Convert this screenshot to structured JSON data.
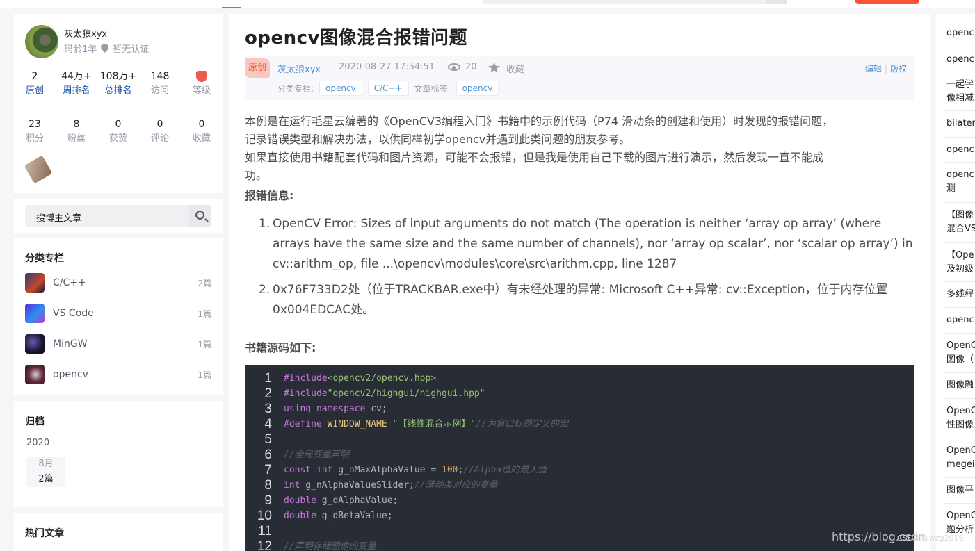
{
  "profile": {
    "name": "灰太狼xyx",
    "age": "码龄1年",
    "cert": "暂无认证",
    "stats_row1": [
      {
        "num": "2",
        "label": "原创"
      },
      {
        "num": "44万+",
        "label": "周排名"
      },
      {
        "num": "108万+",
        "label": "总排名"
      },
      {
        "num": "148",
        "label": "访问"
      },
      {
        "num": "",
        "label": "等级"
      }
    ],
    "stats_row2": [
      {
        "num": "23",
        "label": "积分"
      },
      {
        "num": "8",
        "label": "粉丝"
      },
      {
        "num": "0",
        "label": "获赞"
      },
      {
        "num": "0",
        "label": "评论"
      },
      {
        "num": "0",
        "label": "收藏"
      }
    ]
  },
  "search": {
    "placeholder": "搜博主文章"
  },
  "categories": {
    "title": "分类专栏",
    "items": [
      {
        "name": "C/C++",
        "count": "2篇"
      },
      {
        "name": "VS Code",
        "count": "1篇"
      },
      {
        "name": "MinGW",
        "count": "1篇"
      },
      {
        "name": "opencv",
        "count": "1篇"
      }
    ]
  },
  "archive": {
    "title": "归档",
    "year": "2020",
    "month": "8月",
    "count": "2篇"
  },
  "hot": {
    "title": "热门文章"
  },
  "article": {
    "title": "opencv图像混合报错问题",
    "badge": "原创",
    "author": "灰太狼xyx",
    "date": "2020-08-27 17:54:51",
    "views": "20",
    "fav": "收藏",
    "edit": "编辑",
    "copyright": "版权",
    "column_label": "分类专栏:",
    "columns": [
      "opencv",
      "C/C++"
    ],
    "tag_label": "文章标签:",
    "tags": [
      "opencv"
    ],
    "para1a": "本例是在运行毛星云编著的《OpenCV3编程入门》书籍中的示例代码（P74 滑动条的创建和使用）时发现的报错问题，",
    "para1b": "记录错误类型和解决办法，以供同样初学opencv并遇到此类问题的朋友参考。",
    "para2a": "如果直接使用书籍配套代码和图片资源，可能不会报错，但是我是使用自己下载的图片进行演示，然后发现一直不能成",
    "para2b": "功。",
    "err_heading": "报错信息:",
    "errors": [
      "OpenCV Error: Sizes of input arguments do not match (The operation is neither ‘array op array’ (where arrays have the same size and the same number of channels), nor ‘array op scalar’, nor ‘scalar op array’) in cv::arithm_op, file ...\\opencv\\modules\\core\\src\\arithm.cpp, line 1287",
      "0x76F733D2处（位于TRACKBAR.exe中）有未经处理的异常: Microsoft C++异常: cv::Exception，位于内存位置 0x004EDCAC处。"
    ],
    "code_heading": "书籍源码如下:"
  },
  "code": {
    "line_numbers": [
      "1",
      "2",
      "3",
      "4",
      "5",
      "6",
      "7",
      "8",
      "9",
      "10",
      "11",
      "12"
    ],
    "lines": [
      [
        {
          "t": "#include",
          "c": "kw"
        },
        {
          "t": "<opencv2/opencv.hpp>",
          "c": "str"
        }
      ],
      [
        {
          "t": "#include",
          "c": "kw"
        },
        {
          "t": "\"opencv2/highgui/highgui.hpp\"",
          "c": "str"
        }
      ],
      [
        {
          "t": "using",
          "c": "kw"
        },
        {
          "t": " "
        },
        {
          "t": "namespace",
          "c": "kw"
        },
        {
          "t": " cv;"
        }
      ],
      [
        {
          "t": "#define",
          "c": "kw"
        },
        {
          "t": " WINDOW_NAME ",
          "c": "def"
        },
        {
          "t": "\"【线性混合示例】\"",
          "c": "str"
        },
        {
          "t": "//为窗口标题定义的宏",
          "c": "cmt"
        }
      ],
      [],
      [
        {
          "t": "//全局变量声明",
          "c": "cmt"
        }
      ],
      [
        {
          "t": "const",
          "c": "kw"
        },
        {
          "t": " "
        },
        {
          "t": "int",
          "c": "kw"
        },
        {
          "t": " g_nMaxAlphaValue = "
        },
        {
          "t": "100",
          "c": "num-c"
        },
        {
          "t": ";"
        },
        {
          "t": "//Alpha值的最大值",
          "c": "cmt"
        }
      ],
      [
        {
          "t": "int",
          "c": "kw"
        },
        {
          "t": " g_nAlphaValueSlider;"
        },
        {
          "t": "//滑动条对应的变量",
          "c": "cmt"
        }
      ],
      [
        {
          "t": "double",
          "c": "kw"
        },
        {
          "t": " g_dAlphaValue;"
        }
      ],
      [
        {
          "t": "double",
          "c": "kw"
        },
        {
          "t": " g_dBetaValue;"
        }
      ],
      [],
      [
        {
          "t": "//声明存储图像的变量",
          "c": "cmt"
        }
      ]
    ]
  },
  "right_list": [
    "openc",
    "openc",
    "一起学",
    "像相减",
    "bilater",
    "openc",
    "openc",
    "测",
    "【图像",
    "混合VS",
    "【Ope",
    "及初级",
    "多线程",
    "openc",
    "OpenC",
    "图像（",
    "图像融",
    "OpenC",
    "性图像",
    "OpenC",
    "megei",
    "图像平",
    "OpenC",
    "题分析"
  ],
  "watermark": "https://blog.csdn",
  "watermark_small": "CSDN @wzg2016"
}
